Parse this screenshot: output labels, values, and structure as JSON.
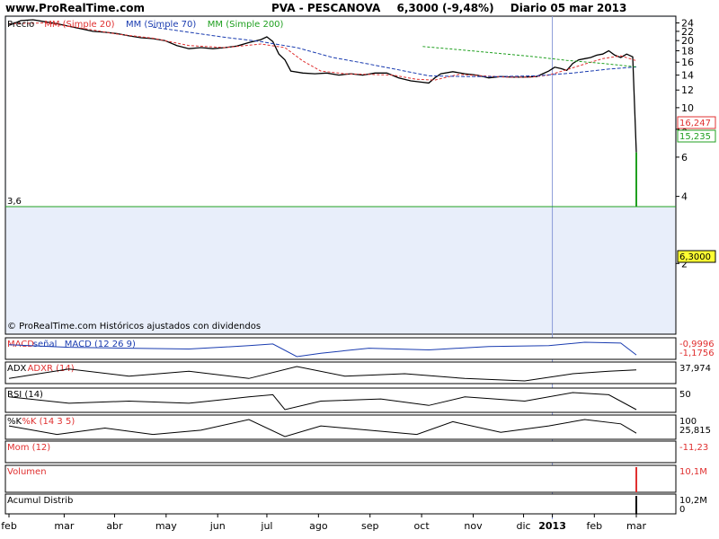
{
  "header": {
    "site": "www.ProRealTime.com",
    "ticker": "PVA - PESCANOVA",
    "price_change": "6,3000 (-9,48%)",
    "period_date": "Diario  05 mar 2013"
  },
  "colors": {
    "panel_bg": "#e8eefa",
    "price_line": "#000000",
    "ma20": "#e03030",
    "ma70": "#1a3cb0",
    "ma200": "#20a020",
    "support": "#20a020",
    "volume": "#e03030",
    "cursor": "#8a9ad8"
  },
  "chart_data": [
    {
      "type": "line",
      "panel": "price",
      "legend": [
        {
          "label": "Precio",
          "color": "#000000"
        },
        {
          "label": "MM (Simple 20)",
          "color": "#e03030"
        },
        {
          "label": "MM (Simple 70)",
          "color": "#1a3cb0"
        },
        {
          "label": "MM (Simple 200)",
          "color": "#20a020"
        }
      ],
      "x_labels": [
        "feb",
        "mar",
        "abr",
        "may",
        "jun",
        "jul",
        "ago",
        "sep",
        "oct",
        "nov",
        "dic",
        "2013",
        "feb",
        "mar"
      ],
      "y_ticks": [
        2,
        4,
        6,
        8,
        10,
        12,
        14,
        16,
        18,
        20,
        22,
        24
      ],
      "ylim": [
        1,
        24.8
      ],
      "log_scale": true,
      "grid": false,
      "support_level": 3.6,
      "support_label": "3,6",
      "note": "© ProRealTime.com Históricos ajustados con dividendos",
      "value_labels": {
        "last_price": "6,3000",
        "ma20": "16,247",
        "ma70": "15,235"
      },
      "series": [
        {
          "name": "Precio",
          "points": [
            [
              0,
              23.4
            ],
            [
              2,
              24.6
            ],
            [
              4,
              24.8
            ],
            [
              6,
              24.3
            ],
            [
              8,
              23.8
            ],
            [
              10,
              23.2
            ],
            [
              12,
              22.6
            ],
            [
              14,
              22.0
            ],
            [
              16,
              21.8
            ],
            [
              18,
              21.5
            ],
            [
              20,
              21.0
            ],
            [
              22,
              20.6
            ],
            [
              24,
              20.4
            ],
            [
              26,
              20.0
            ],
            [
              28,
              19.0
            ],
            [
              30,
              18.4
            ],
            [
              32,
              18.6
            ],
            [
              34,
              18.4
            ],
            [
              36,
              18.6
            ],
            [
              38,
              18.9
            ],
            [
              40,
              19.6
            ],
            [
              42,
              20.2
            ],
            [
              43,
              20.8
            ],
            [
              44,
              19.8
            ],
            [
              45,
              17.4
            ],
            [
              46,
              16.4
            ],
            [
              47,
              14.6
            ],
            [
              49,
              14.3
            ],
            [
              51,
              14.2
            ],
            [
              53,
              14.3
            ],
            [
              55,
              14.0
            ],
            [
              57,
              14.2
            ],
            [
              59,
              14.0
            ],
            [
              61,
              14.3
            ],
            [
              63,
              14.3
            ],
            [
              65,
              13.6
            ],
            [
              67,
              13.2
            ],
            [
              69,
              13.0
            ],
            [
              70,
              12.9
            ],
            [
              71,
              13.6
            ],
            [
              72,
              14.2
            ],
            [
              74,
              14.5
            ],
            [
              76,
              14.2
            ],
            [
              78,
              14.0
            ],
            [
              80,
              13.6
            ],
            [
              82,
              13.8
            ],
            [
              84,
              13.7
            ],
            [
              86,
              13.7
            ],
            [
              88,
              13.8
            ],
            [
              89,
              14.2
            ],
            [
              90,
              14.6
            ],
            [
              91,
              15.2
            ],
            [
              92,
              15.0
            ],
            [
              93,
              14.7
            ],
            [
              94,
              15.8
            ],
            [
              95,
              16.4
            ],
            [
              96,
              16.6
            ],
            [
              97,
              16.8
            ],
            [
              98,
              17.2
            ],
            [
              99,
              17.4
            ],
            [
              100,
              18.0
            ],
            [
              101,
              17.2
            ],
            [
              102,
              16.8
            ],
            [
              103,
              17.4
            ],
            [
              104,
              16.9
            ],
            [
              104.6,
              6.3
            ]
          ]
        },
        {
          "name": "MM (Simple 20)",
          "points": [
            [
              0,
              23.8
            ],
            [
              6,
              24.0
            ],
            [
              12,
              22.8
            ],
            [
              18,
              21.4
            ],
            [
              24,
              20.5
            ],
            [
              30,
              19.0
            ],
            [
              36,
              18.6
            ],
            [
              42,
              19.3
            ],
            [
              46,
              18.6
            ],
            [
              49,
              16.2
            ],
            [
              52,
              14.6
            ],
            [
              56,
              14.2
            ],
            [
              60,
              14.1
            ],
            [
              64,
              14.0
            ],
            [
              68,
              13.4
            ],
            [
              71,
              13.3
            ],
            [
              75,
              14.1
            ],
            [
              79,
              13.9
            ],
            [
              83,
              13.7
            ],
            [
              87,
              13.7
            ],
            [
              90,
              14.0
            ],
            [
              93,
              14.8
            ],
            [
              96,
              15.7
            ],
            [
              99,
              16.6
            ],
            [
              102,
              17.1
            ],
            [
              104.6,
              16.25
            ]
          ]
        },
        {
          "name": "MM (Simple 70)",
          "points": [
            [
              24,
              23.0
            ],
            [
              30,
              21.8
            ],
            [
              36,
              20.7
            ],
            [
              42,
              19.8
            ],
            [
              48,
              18.6
            ],
            [
              54,
              16.8
            ],
            [
              60,
              15.7
            ],
            [
              66,
              14.6
            ],
            [
              70,
              13.9
            ],
            [
              76,
              13.8
            ],
            [
              82,
              13.8
            ],
            [
              88,
              13.9
            ],
            [
              94,
              14.3
            ],
            [
              100,
              14.9
            ],
            [
              104.6,
              15.24
            ]
          ]
        },
        {
          "name": "MM (Simple 200)",
          "points": [
            [
              69,
              18.8
            ],
            [
              75,
              18.2
            ],
            [
              81,
              17.6
            ],
            [
              87,
              17.0
            ],
            [
              93,
              16.3
            ],
            [
              99,
              15.8
            ],
            [
              104.6,
              15.24
            ]
          ]
        }
      ]
    },
    {
      "type": "area",
      "panel": "macd",
      "legend": [
        {
          "label": "MACD",
          "color": "#e03030"
        },
        {
          "label": "señal",
          "color": "#1a3cb0"
        },
        {
          "label": "MACD (12 26 9)",
          "color": "#1a3cb0"
        }
      ],
      "value_labels": [
        "-0,9996",
        "-1,1756"
      ],
      "series": [
        {
          "name": "MACD",
          "points": [
            [
              0,
              0.2
            ],
            [
              10,
              -0.1
            ],
            [
              20,
              -0.2
            ],
            [
              30,
              -0.3
            ],
            [
              40,
              0.1
            ],
            [
              44,
              0.3
            ],
            [
              48,
              -1.2
            ],
            [
              52,
              -0.8
            ],
            [
              60,
              -0.2
            ],
            [
              70,
              -0.4
            ],
            [
              80,
              0.0
            ],
            [
              90,
              0.1
            ],
            [
              96,
              0.5
            ],
            [
              102,
              0.4
            ],
            [
              104.6,
              -1.0
            ]
          ]
        }
      ]
    },
    {
      "type": "line",
      "panel": "adx",
      "legend": [
        {
          "label": "ADX",
          "color": "#000000"
        },
        {
          "label": "ADXR (14)",
          "color": "#e03030"
        }
      ],
      "value_labels": [
        "37,974"
      ],
      "series": [
        {
          "name": "ADX",
          "points": [
            [
              0,
              20
            ],
            [
              10,
              40
            ],
            [
              20,
              25
            ],
            [
              30,
              35
            ],
            [
              40,
              20
            ],
            [
              48,
              45
            ],
            [
              56,
              25
            ],
            [
              66,
              30
            ],
            [
              76,
              20
            ],
            [
              86,
              15
            ],
            [
              94,
              30
            ],
            [
              100,
              35
            ],
            [
              104.6,
              38
            ]
          ]
        }
      ]
    },
    {
      "type": "line",
      "panel": "rsi",
      "legend": [
        {
          "label": "RSI (14)",
          "color": "#000000"
        }
      ],
      "value_labels": [
        "50"
      ],
      "series": [
        {
          "name": "RSI (14)",
          "points": [
            [
              0,
              55
            ],
            [
              10,
              40
            ],
            [
              20,
              45
            ],
            [
              30,
              40
            ],
            [
              40,
              55
            ],
            [
              44,
              60
            ],
            [
              46,
              25
            ],
            [
              52,
              45
            ],
            [
              62,
              50
            ],
            [
              70,
              35
            ],
            [
              76,
              55
            ],
            [
              86,
              45
            ],
            [
              94,
              65
            ],
            [
              100,
              60
            ],
            [
              104.6,
              25
            ]
          ]
        }
      ]
    },
    {
      "type": "line",
      "panel": "stoch",
      "legend": [
        {
          "label": "%K",
          "color": "#000000"
        },
        {
          "label": "%K (14 3 5)",
          "color": "#e03030"
        }
      ],
      "value_labels": [
        "100",
        "25,815"
      ],
      "series": [
        {
          "name": "%K",
          "points": [
            [
              0,
              60
            ],
            [
              8,
              20
            ],
            [
              16,
              50
            ],
            [
              24,
              20
            ],
            [
              32,
              40
            ],
            [
              40,
              90
            ],
            [
              46,
              10
            ],
            [
              52,
              60
            ],
            [
              60,
              40
            ],
            [
              68,
              20
            ],
            [
              74,
              80
            ],
            [
              82,
              30
            ],
            [
              90,
              60
            ],
            [
              96,
              90
            ],
            [
              102,
              70
            ],
            [
              104.6,
              26
            ]
          ]
        }
      ]
    },
    {
      "type": "area",
      "panel": "momentum",
      "legend": [
        {
          "label": "Mom (12)",
          "color": "#e03030"
        }
      ],
      "value_labels": [
        "-11,23"
      ]
    },
    {
      "type": "bar",
      "panel": "volume",
      "legend": [
        {
          "label": "Volumen",
          "color": "#e03030"
        }
      ],
      "value_labels": [
        "10,1M"
      ]
    },
    {
      "type": "area",
      "panel": "accum",
      "legend": [
        {
          "label": "Acumul Distrib",
          "color": "#000000"
        }
      ],
      "value_labels": [
        "10,2M",
        "0"
      ]
    }
  ]
}
